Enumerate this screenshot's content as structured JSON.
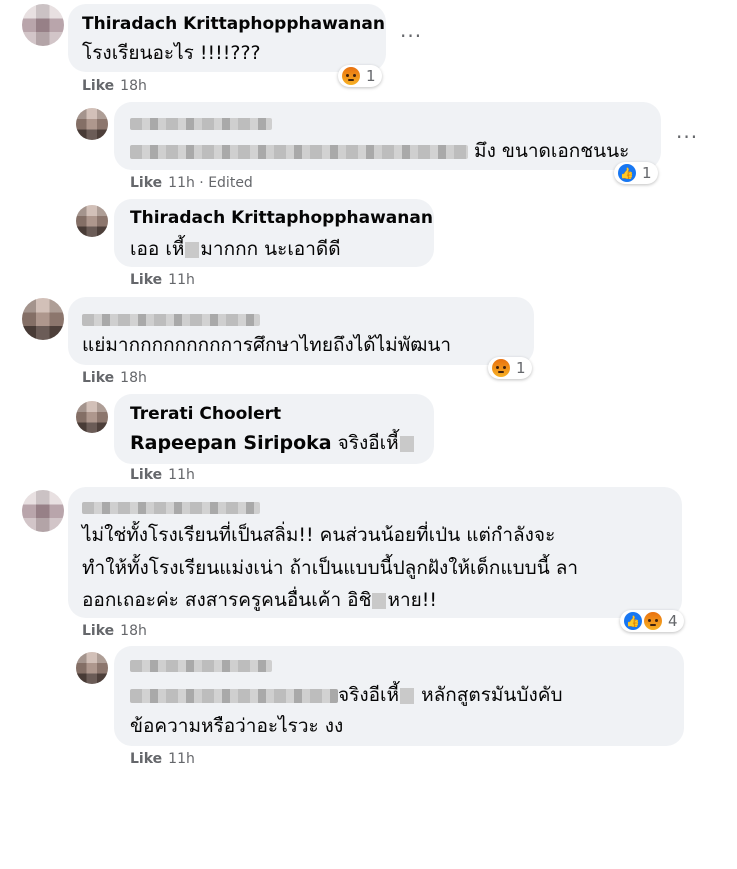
{
  "comments": [
    {
      "author": "Thiradach Krittaphopphawanan",
      "text": "โรงเรียนอะไร !!!!???",
      "like": "Like",
      "time": "18h",
      "reactions": {
        "icons": [
          "angry-icon"
        ],
        "count": "1"
      },
      "more": "···"
    },
    {
      "author_blurred": true,
      "text_suffix": "มึง ขนาดเอกชนนะ",
      "like": "Like",
      "time": "11h",
      "edited": "Edited",
      "reactions": {
        "icons": [
          "like-icon"
        ],
        "count": "1"
      },
      "more": "···"
    },
    {
      "author": "Thiradach Krittaphopphawanan",
      "text_a": "เออ เหี้",
      "text_b": "มากกก นะเอาดีดี",
      "like": "Like",
      "time": "11h"
    },
    {
      "author_blurred": true,
      "text": "แย่มากกกกกกกกการศึกษาไทยถึงได้ไม่พัฒนา",
      "like": "Like",
      "time": "18h",
      "reactions": {
        "icons": [
          "angry-icon"
        ],
        "count": "1"
      }
    },
    {
      "author": "Trerati Choolert",
      "mention": "Rapeepan Siripoka",
      "text_a": "จริงอีเหี้",
      "like": "Like",
      "time": "11h"
    },
    {
      "author_blurred": true,
      "line1": "ไม่ใช่ทั้งโรงเรียนที่เป็นสลิ่ม!! คนส่วนน้อยที่เป่น แต่กำลังจะ",
      "line2": "ทำให้ทั้งโรงเรียนแม่งเน่า ถ้าเป็นแบบนี้ปลูกฝังให้เด็กแบบนี้ ลา",
      "line3a": "ออกเถอะค่ะ สงสารครูคนอื่นเค้า อิชิ",
      "line3b": "หาย!!",
      "like": "Like",
      "time": "18h",
      "reactions": {
        "icons": [
          "like-icon",
          "angry-icon"
        ],
        "count": "4"
      }
    },
    {
      "author_blurred": true,
      "line1a": "จริงอีเหี้",
      "line1b": "หลักสูตรมันบังคับ",
      "line2": "ข้อความหรือว่าอะไรวะ งง",
      "like": "Like",
      "time": "11h"
    }
  ],
  "separator": "·"
}
